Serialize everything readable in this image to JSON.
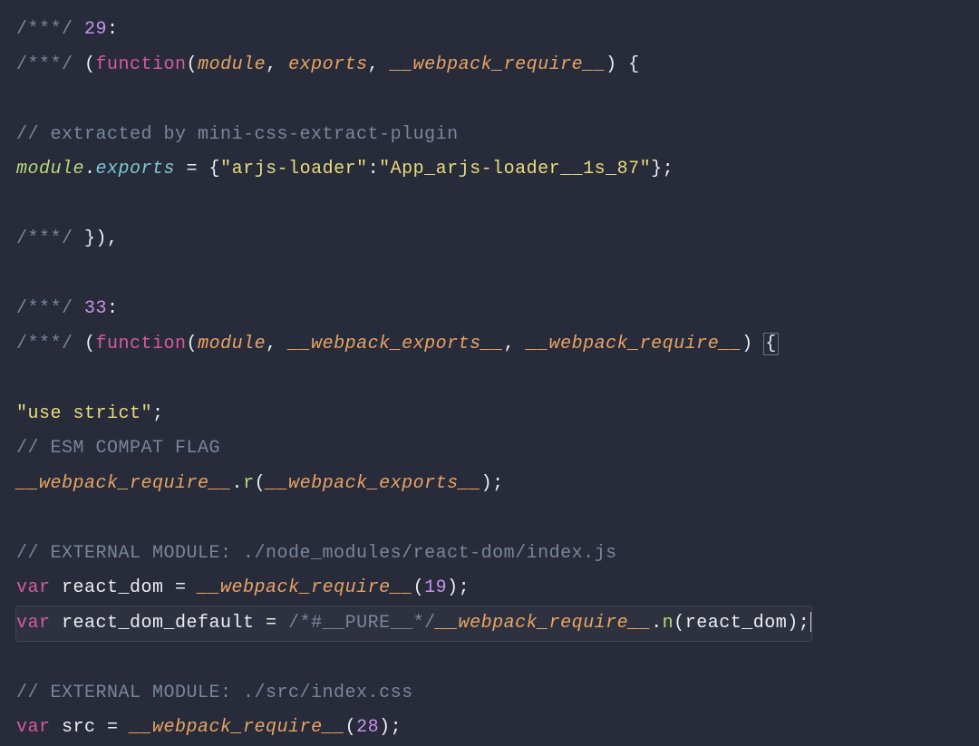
{
  "code": {
    "l1_c1": "/***/",
    "l1_num": " 29",
    "l1_colon": ":",
    "l2_c1": "/***/",
    "l2_sp": " (",
    "l2_fn": "function",
    "l2_op": "(",
    "l2_p1": "module",
    "l2_c2": ", ",
    "l2_p2": "exports",
    "l2_c3": ", ",
    "l2_p3": "__webpack_require__",
    "l2_cp": ") {",
    "l4_cmt": "// extracted by mini-css-extract-plugin",
    "l5_mod": "module",
    "l5_dot": ".",
    "l5_exp": "exports",
    "l5_eq": " = {",
    "l5_k": "\"arjs-loader\"",
    "l5_col": ":",
    "l5_v": "\"App_arjs-loader__1s_87\"",
    "l5_end": "};",
    "l7_c1": "/***/",
    "l7_end": " }),",
    "l9_c1": "/***/",
    "l9_num": " 33",
    "l9_colon": ":",
    "l10_c1": "/***/",
    "l10_sp": " (",
    "l10_fn": "function",
    "l10_op": "(",
    "l10_p1": "module",
    "l10_c2": ", ",
    "l10_p2": "__webpack_exports__",
    "l10_c3": ", ",
    "l10_p3": "__webpack_require__",
    "l10_cp": ") ",
    "l10_brace": "{",
    "l12_str": "\"use strict\"",
    "l12_semi": ";",
    "l13_cmt": "// ESM COMPAT FLAG",
    "l14_wr": "__webpack_require__",
    "l14_dot": ".",
    "l14_r": "r",
    "l14_op": "(",
    "l14_we": "__webpack_exports__",
    "l14_cp": ");",
    "l16_cmt": "// EXTERNAL MODULE: ./node_modules/react-dom/index.js",
    "l17_var": "var",
    "l17_name": " react_dom = ",
    "l17_wr": "__webpack_require__",
    "l17_op": "(",
    "l17_num": "19",
    "l17_cp": ");",
    "l18_var": "var",
    "l18_name": " react_dom_default = ",
    "l18_pure": "/*#__PURE__*/",
    "l18_wr": "__webpack_require__",
    "l18_dot": ".",
    "l18_n": "n",
    "l18_op": "(",
    "l18_arg": "react_dom",
    "l18_cp": ");",
    "l20_cmt": "// EXTERNAL MODULE: ./src/index.css",
    "l21_var": "var",
    "l21_name": " src = ",
    "l21_wr": "__webpack_require__",
    "l21_op": "(",
    "l21_num": "28",
    "l21_cp": ");"
  }
}
